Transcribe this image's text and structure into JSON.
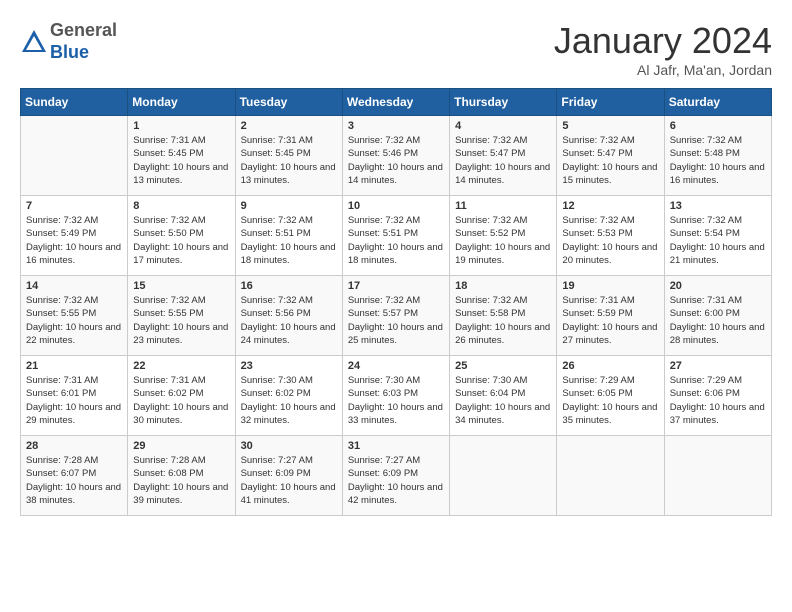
{
  "header": {
    "logo_line1": "General",
    "logo_line2": "Blue",
    "month": "January 2024",
    "location": "Al Jafr, Ma'an, Jordan"
  },
  "weekdays": [
    "Sunday",
    "Monday",
    "Tuesday",
    "Wednesday",
    "Thursday",
    "Friday",
    "Saturday"
  ],
  "weeks": [
    [
      {
        "day": "",
        "sunrise": "",
        "sunset": "",
        "daylight": ""
      },
      {
        "day": "1",
        "sunrise": "7:31 AM",
        "sunset": "5:45 PM",
        "daylight": "10 hours and 13 minutes."
      },
      {
        "day": "2",
        "sunrise": "7:31 AM",
        "sunset": "5:45 PM",
        "daylight": "10 hours and 13 minutes."
      },
      {
        "day": "3",
        "sunrise": "7:32 AM",
        "sunset": "5:46 PM",
        "daylight": "10 hours and 14 minutes."
      },
      {
        "day": "4",
        "sunrise": "7:32 AM",
        "sunset": "5:47 PM",
        "daylight": "10 hours and 14 minutes."
      },
      {
        "day": "5",
        "sunrise": "7:32 AM",
        "sunset": "5:47 PM",
        "daylight": "10 hours and 15 minutes."
      },
      {
        "day": "6",
        "sunrise": "7:32 AM",
        "sunset": "5:48 PM",
        "daylight": "10 hours and 16 minutes."
      }
    ],
    [
      {
        "day": "7",
        "sunrise": "7:32 AM",
        "sunset": "5:49 PM",
        "daylight": "10 hours and 16 minutes."
      },
      {
        "day": "8",
        "sunrise": "7:32 AM",
        "sunset": "5:50 PM",
        "daylight": "10 hours and 17 minutes."
      },
      {
        "day": "9",
        "sunrise": "7:32 AM",
        "sunset": "5:51 PM",
        "daylight": "10 hours and 18 minutes."
      },
      {
        "day": "10",
        "sunrise": "7:32 AM",
        "sunset": "5:51 PM",
        "daylight": "10 hours and 18 minutes."
      },
      {
        "day": "11",
        "sunrise": "7:32 AM",
        "sunset": "5:52 PM",
        "daylight": "10 hours and 19 minutes."
      },
      {
        "day": "12",
        "sunrise": "7:32 AM",
        "sunset": "5:53 PM",
        "daylight": "10 hours and 20 minutes."
      },
      {
        "day": "13",
        "sunrise": "7:32 AM",
        "sunset": "5:54 PM",
        "daylight": "10 hours and 21 minutes."
      }
    ],
    [
      {
        "day": "14",
        "sunrise": "7:32 AM",
        "sunset": "5:55 PM",
        "daylight": "10 hours and 22 minutes."
      },
      {
        "day": "15",
        "sunrise": "7:32 AM",
        "sunset": "5:55 PM",
        "daylight": "10 hours and 23 minutes."
      },
      {
        "day": "16",
        "sunrise": "7:32 AM",
        "sunset": "5:56 PM",
        "daylight": "10 hours and 24 minutes."
      },
      {
        "day": "17",
        "sunrise": "7:32 AM",
        "sunset": "5:57 PM",
        "daylight": "10 hours and 25 minutes."
      },
      {
        "day": "18",
        "sunrise": "7:32 AM",
        "sunset": "5:58 PM",
        "daylight": "10 hours and 26 minutes."
      },
      {
        "day": "19",
        "sunrise": "7:31 AM",
        "sunset": "5:59 PM",
        "daylight": "10 hours and 27 minutes."
      },
      {
        "day": "20",
        "sunrise": "7:31 AM",
        "sunset": "6:00 PM",
        "daylight": "10 hours and 28 minutes."
      }
    ],
    [
      {
        "day": "21",
        "sunrise": "7:31 AM",
        "sunset": "6:01 PM",
        "daylight": "10 hours and 29 minutes."
      },
      {
        "day": "22",
        "sunrise": "7:31 AM",
        "sunset": "6:02 PM",
        "daylight": "10 hours and 30 minutes."
      },
      {
        "day": "23",
        "sunrise": "7:30 AM",
        "sunset": "6:02 PM",
        "daylight": "10 hours and 32 minutes."
      },
      {
        "day": "24",
        "sunrise": "7:30 AM",
        "sunset": "6:03 PM",
        "daylight": "10 hours and 33 minutes."
      },
      {
        "day": "25",
        "sunrise": "7:30 AM",
        "sunset": "6:04 PM",
        "daylight": "10 hours and 34 minutes."
      },
      {
        "day": "26",
        "sunrise": "7:29 AM",
        "sunset": "6:05 PM",
        "daylight": "10 hours and 35 minutes."
      },
      {
        "day": "27",
        "sunrise": "7:29 AM",
        "sunset": "6:06 PM",
        "daylight": "10 hours and 37 minutes."
      }
    ],
    [
      {
        "day": "28",
        "sunrise": "7:28 AM",
        "sunset": "6:07 PM",
        "daylight": "10 hours and 38 minutes."
      },
      {
        "day": "29",
        "sunrise": "7:28 AM",
        "sunset": "6:08 PM",
        "daylight": "10 hours and 39 minutes."
      },
      {
        "day": "30",
        "sunrise": "7:27 AM",
        "sunset": "6:09 PM",
        "daylight": "10 hours and 41 minutes."
      },
      {
        "day": "31",
        "sunrise": "7:27 AM",
        "sunset": "6:09 PM",
        "daylight": "10 hours and 42 minutes."
      },
      {
        "day": "",
        "sunrise": "",
        "sunset": "",
        "daylight": ""
      },
      {
        "day": "",
        "sunrise": "",
        "sunset": "",
        "daylight": ""
      },
      {
        "day": "",
        "sunrise": "",
        "sunset": "",
        "daylight": ""
      }
    ]
  ]
}
